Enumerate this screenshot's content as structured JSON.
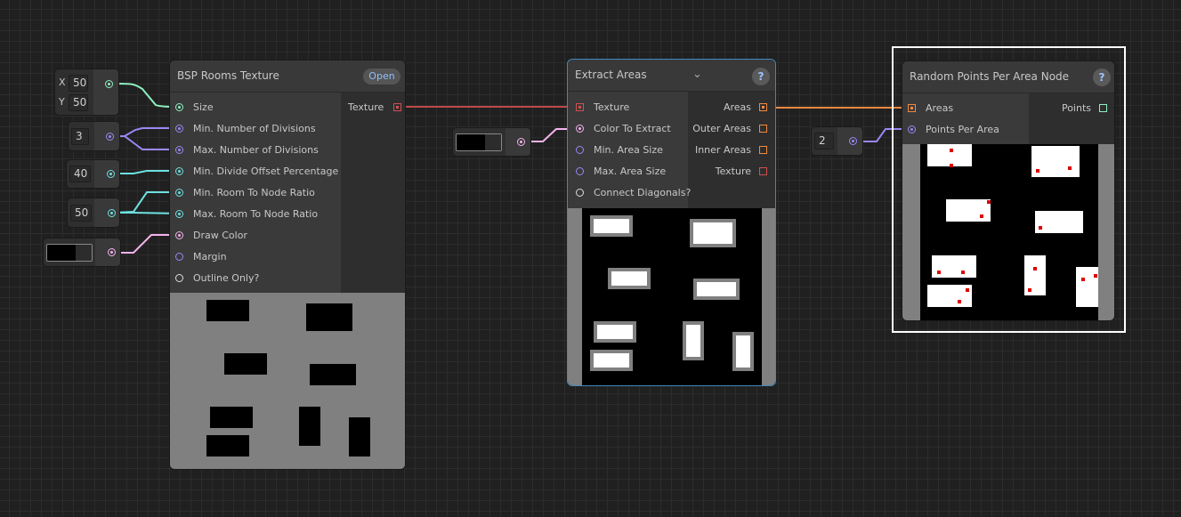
{
  "bsp_node": {
    "title": "BSP Rooms Texture",
    "open_label": "Open",
    "inputs": [
      "Size",
      "Min. Number of Divisions",
      "Max. Number of Divisions",
      "Min. Divide Offset Percentage",
      "Min. Room To Node Ratio",
      "Max. Room To Node Ratio",
      "Draw Color",
      "Margin",
      "Outline Only?"
    ],
    "output": "Texture"
  },
  "extract_node": {
    "title": "Extract Areas",
    "inputs": [
      "Texture",
      "Color To Extract",
      "Min. Area Size",
      "Max. Area Size",
      "Connect Diagonals?"
    ],
    "outputs": [
      "Areas",
      "Outer Areas",
      "Inner Areas",
      "Texture"
    ],
    "help": "?"
  },
  "random_node": {
    "title": "Random Points Per Area Node",
    "inputs": [
      "Areas",
      "Points Per Area"
    ],
    "outputs": [
      "Points"
    ],
    "help": "?"
  },
  "value_nodes": {
    "size_x_label": "X",
    "size_x": "50",
    "size_y_label": "Y",
    "size_y": "50",
    "divisions": "3",
    "offset": "40",
    "ratio": "50",
    "points_per_area": "2"
  },
  "colors": {
    "size_port": "#8ff0c0",
    "int_port": "#9b87f5",
    "float_port": "#6fe0e0",
    "color_port": "#f5b3ee",
    "texture_port": "#d05050",
    "areas_port": "#f08a40",
    "points_port": "#8ff0c0",
    "selection": "#ffffff",
    "extract_border": "#3d8ab8",
    "draw_color": "#000000"
  }
}
